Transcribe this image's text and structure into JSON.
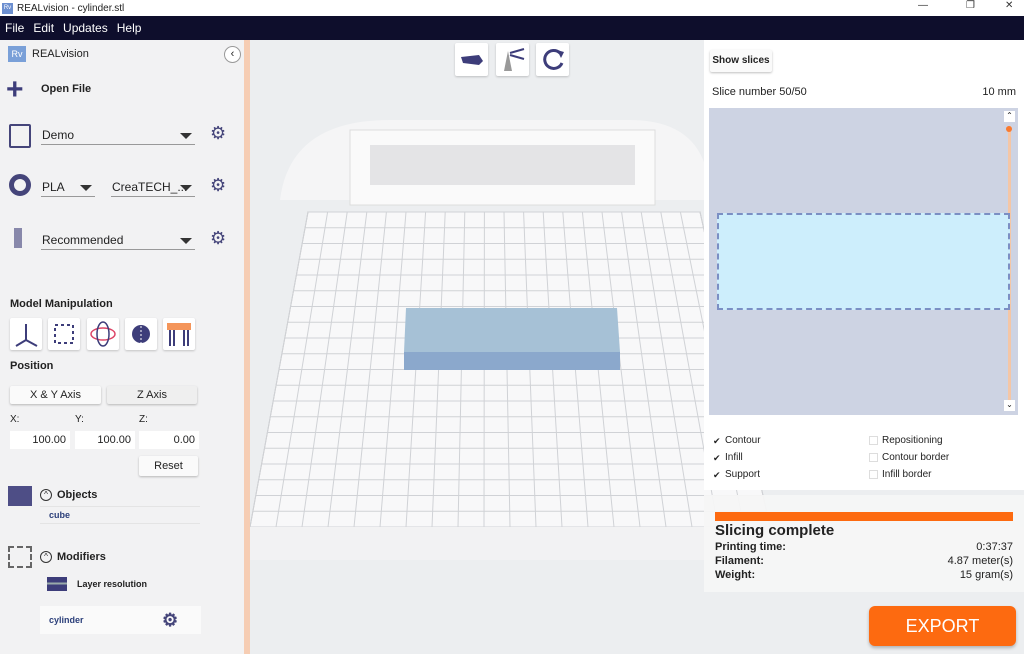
{
  "window": {
    "title": "REALvision - cylinder.stl",
    "logo": "Rv"
  },
  "menu": [
    "File",
    "Edit",
    "Updates",
    "Help"
  ],
  "sidebar": {
    "brand": "REALvision",
    "brand_logo": "Rv",
    "open_file": "Open File",
    "printer": "Demo",
    "material": "PLA",
    "material_brand": "CreaTECH_...",
    "profile": "Recommended",
    "model_manipulation": "Model Manipulation",
    "position": "Position",
    "xy_axis": "X & Y Axis",
    "z_axis": "Z Axis",
    "x_label": "X:",
    "y_label": "Y:",
    "z_label": "Z:",
    "x": "100.00",
    "y": "100.00",
    "z": "0.00",
    "reset": "Reset",
    "objects": "Objects",
    "object_item": "cube",
    "modifiers": "Modifiers",
    "layer_resolution": "Layer resolution",
    "modifier_item": "cylinder"
  },
  "slices": {
    "show": "Show slices",
    "number": "Slice number 50/50",
    "height": "10 mm",
    "checks": [
      {
        "label": "Contour",
        "checked": true
      },
      {
        "label": "Infill",
        "checked": true
      },
      {
        "label": "Support",
        "checked": true
      },
      {
        "label": "Repositioning",
        "checked": false
      },
      {
        "label": "Contour border",
        "checked": false
      },
      {
        "label": "Infill border",
        "checked": false
      }
    ],
    "slider_percent": 100
  },
  "status": {
    "title": "Slicing complete",
    "progress_percent": 100,
    "printing_time_label": "Printing time:",
    "printing_time": "0:37:37",
    "filament_label": "Filament:",
    "filament": "4.87  meter(s)",
    "weight_label": "Weight:",
    "weight": "15  gram(s)"
  },
  "export": "EXPORT",
  "colors": {
    "accent": "#fd6a10",
    "menubar": "#0e0e2c",
    "icon": "#45457a",
    "model": "#9fb8d8"
  }
}
